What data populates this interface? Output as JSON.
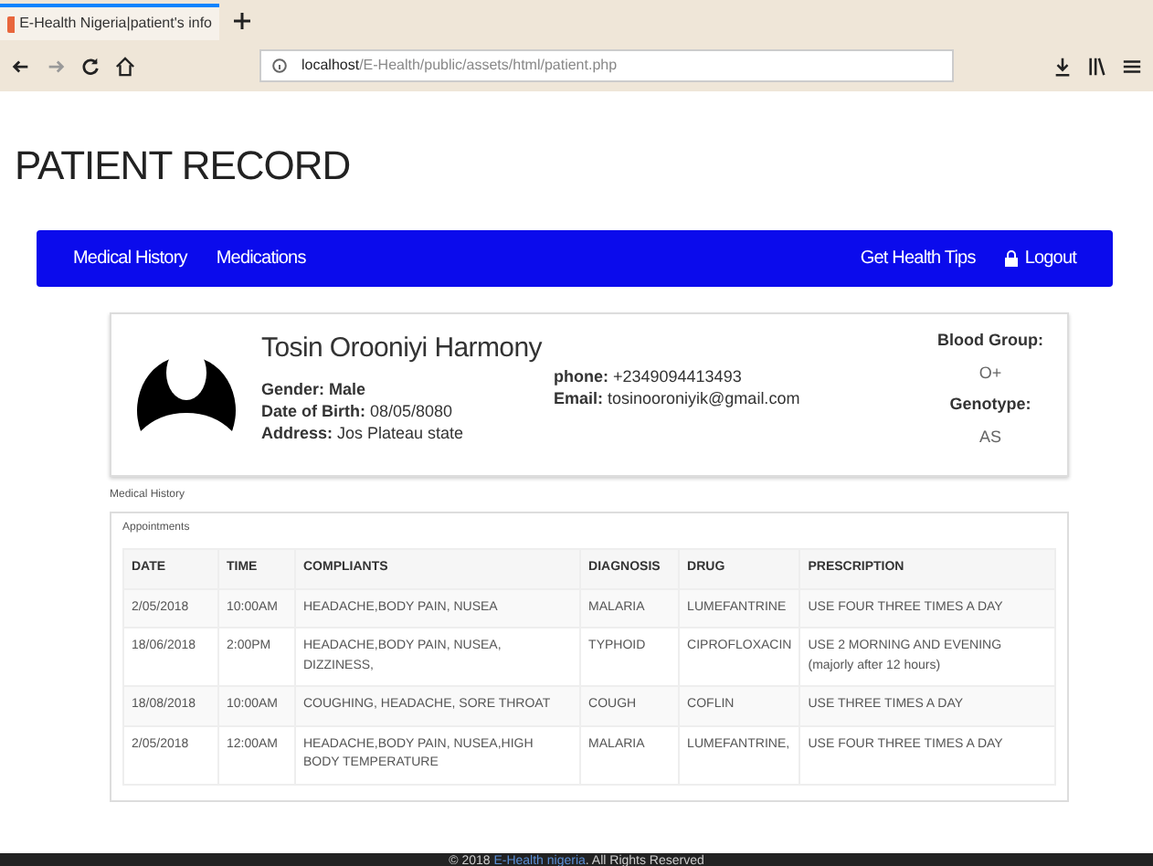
{
  "browser": {
    "tab_title": "E-Health Nigeria|patient's info",
    "url_host": "localhost",
    "url_path": "/E-Health/public/assets/html/patient.php"
  },
  "page_title": "PATIENT RECORD",
  "navbar": {
    "left": [
      "Medical History",
      "Medications"
    ],
    "right": [
      {
        "label": "Get Health Tips",
        "kind": "plain"
      },
      {
        "label": "Logout",
        "kind": "lock"
      }
    ]
  },
  "patient": {
    "name": "Tosin Orooniyi Harmony",
    "details": [
      {
        "label": "Gender:",
        "value": "Male",
        "bold": true
      },
      {
        "label": "Date of Birth:",
        "value": "08/05/8080",
        "bold": false
      },
      {
        "label": "Address:",
        "value": "Jos Plateau state",
        "bold": false
      }
    ],
    "contacts": [
      {
        "label": "phone:",
        "value": "+2349094413493"
      },
      {
        "label": "Email:",
        "value": "tosinooroniyik@gmail.com"
      }
    ],
    "blood_group_label": "Blood Group:",
    "blood_group": "O+",
    "genotype_label": "Genotype:",
    "genotype": "AS"
  },
  "section_label": "Medical History",
  "appointments": {
    "title": "Appointments",
    "columns": [
      "DATE",
      "TIME",
      "COMPLIANTS",
      "DIAGNOSIS",
      "DRUG",
      "PRESCRIPTION"
    ],
    "rows": [
      [
        "2/05/2018",
        "10:00AM",
        "HEADACHE,BODY PAIN, NUSEA",
        "MALARIA",
        "LUMEFANTRINE",
        "USE FOUR THREE TIMES A DAY"
      ],
      [
        "18/06/2018",
        "2:00PM",
        "HEADACHE,BODY PAIN, NUSEA, DIZZINESS,",
        "TYPHOID",
        "CIPROFLOXACIN",
        "USE 2 MORNING AND EVENING (majorly after 12 hours)"
      ],
      [
        "18/08/2018",
        "10:00AM",
        "COUGHING, HEADACHE, SORE THROAT",
        "COUGH",
        "COFLIN",
        "USE THREE TIMES A DAY"
      ],
      [
        "2/05/2018",
        "12:00AM",
        "HEADACHE,BODY PAIN, NUSEA,HIGH BODY TEMPERATURE",
        "MALARIA",
        "LUMEFANTRINE,",
        "USE FOUR THREE TIMES A DAY"
      ]
    ]
  },
  "footer": {
    "before": "© 2018",
    "link": "E-Health nigeria",
    "after": ". All Rights Reserved"
  }
}
